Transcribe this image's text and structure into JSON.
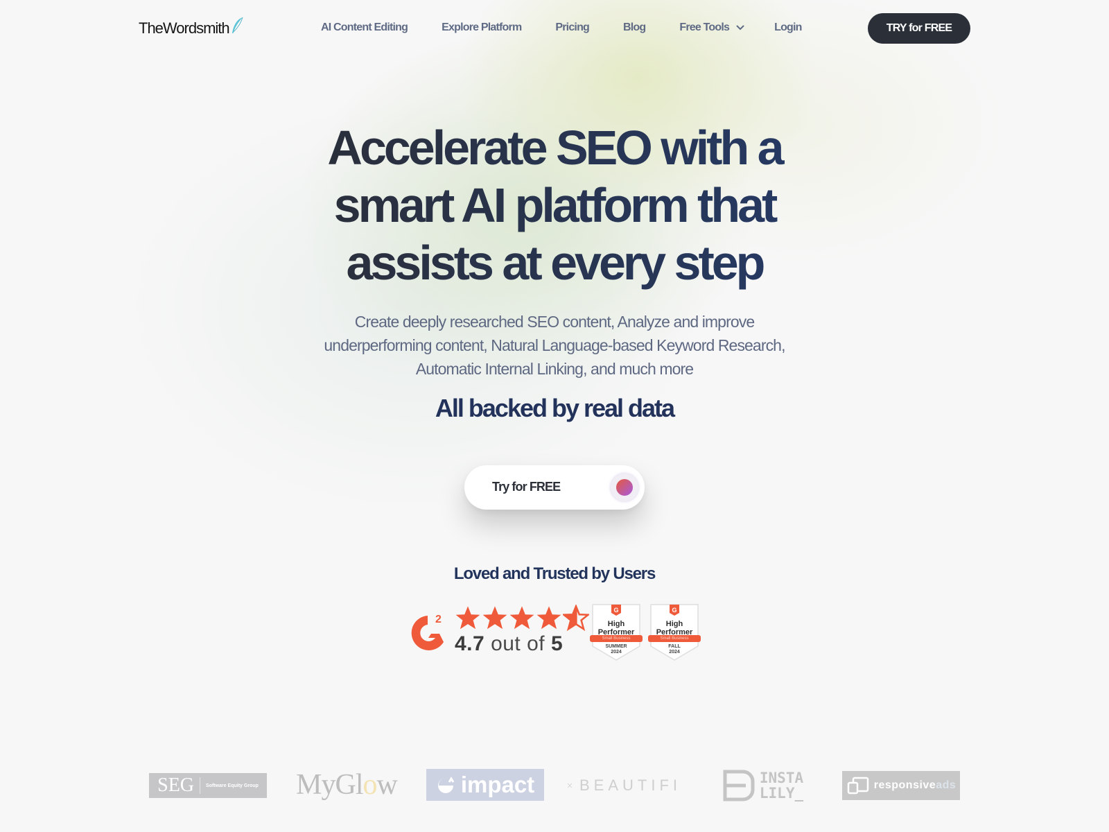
{
  "nav": {
    "brand": "TheWordsmith",
    "brand_icon": "quill-icon",
    "links": [
      {
        "label": "AI Content Editing"
      },
      {
        "label": "Explore Platform"
      },
      {
        "label": "Pricing"
      },
      {
        "label": "Blog"
      },
      {
        "label": "Free Tools",
        "has_dropdown": true,
        "icon": "chevron-down-icon"
      },
      {
        "label": "Login"
      }
    ],
    "cta_label": "TRY for FREE"
  },
  "hero": {
    "title_lines": [
      "Accelerate SEO with a",
      "smart AI platform that",
      "assists at every step"
    ],
    "subtitle_lines": [
      "Create deeply researched SEO content, Analyze and improve",
      "underperforming content, Natural Language-based Keyword Research,",
      "Automatic Internal Linking, and much more"
    ],
    "tagline": "All backed by real data",
    "cta_label": "Try for FREE",
    "cta_icon": "gradient-orb-icon"
  },
  "trust": {
    "title": "Loved and Trusted by Users",
    "g2": {
      "logo": "g2-logo",
      "rating": "4.7",
      "rating_mid": "out of",
      "rating_max": "5",
      "stars_filled": 4.7,
      "stars_total": 5
    },
    "badges": [
      {
        "line1": "High",
        "line2": "Performer",
        "segment": "Small Business",
        "season": "SUMMER",
        "year": "2024"
      },
      {
        "line1": "High",
        "line2": "Performer",
        "segment": "Small Business",
        "season": "FALL",
        "year": "2024"
      }
    ]
  },
  "clients": {
    "seg": {
      "big": "SEG",
      "small": "Software Equity Group"
    },
    "myglow": {
      "a": "MyGl",
      "o": "o",
      "b": "w"
    },
    "impact": {
      "label": "impact"
    },
    "beautifi": {
      "label": "BEAUTIFI"
    },
    "instalily": {
      "line1": "INSTA",
      "line2": "LILY_"
    },
    "responsive": {
      "a": "responsive",
      "b": "ads"
    }
  },
  "colors": {
    "nav_cta_bg": "#2b2f38",
    "heading": "#22345c",
    "g2_orange": "#ef5a3a",
    "quill": "#5bc3d6"
  }
}
